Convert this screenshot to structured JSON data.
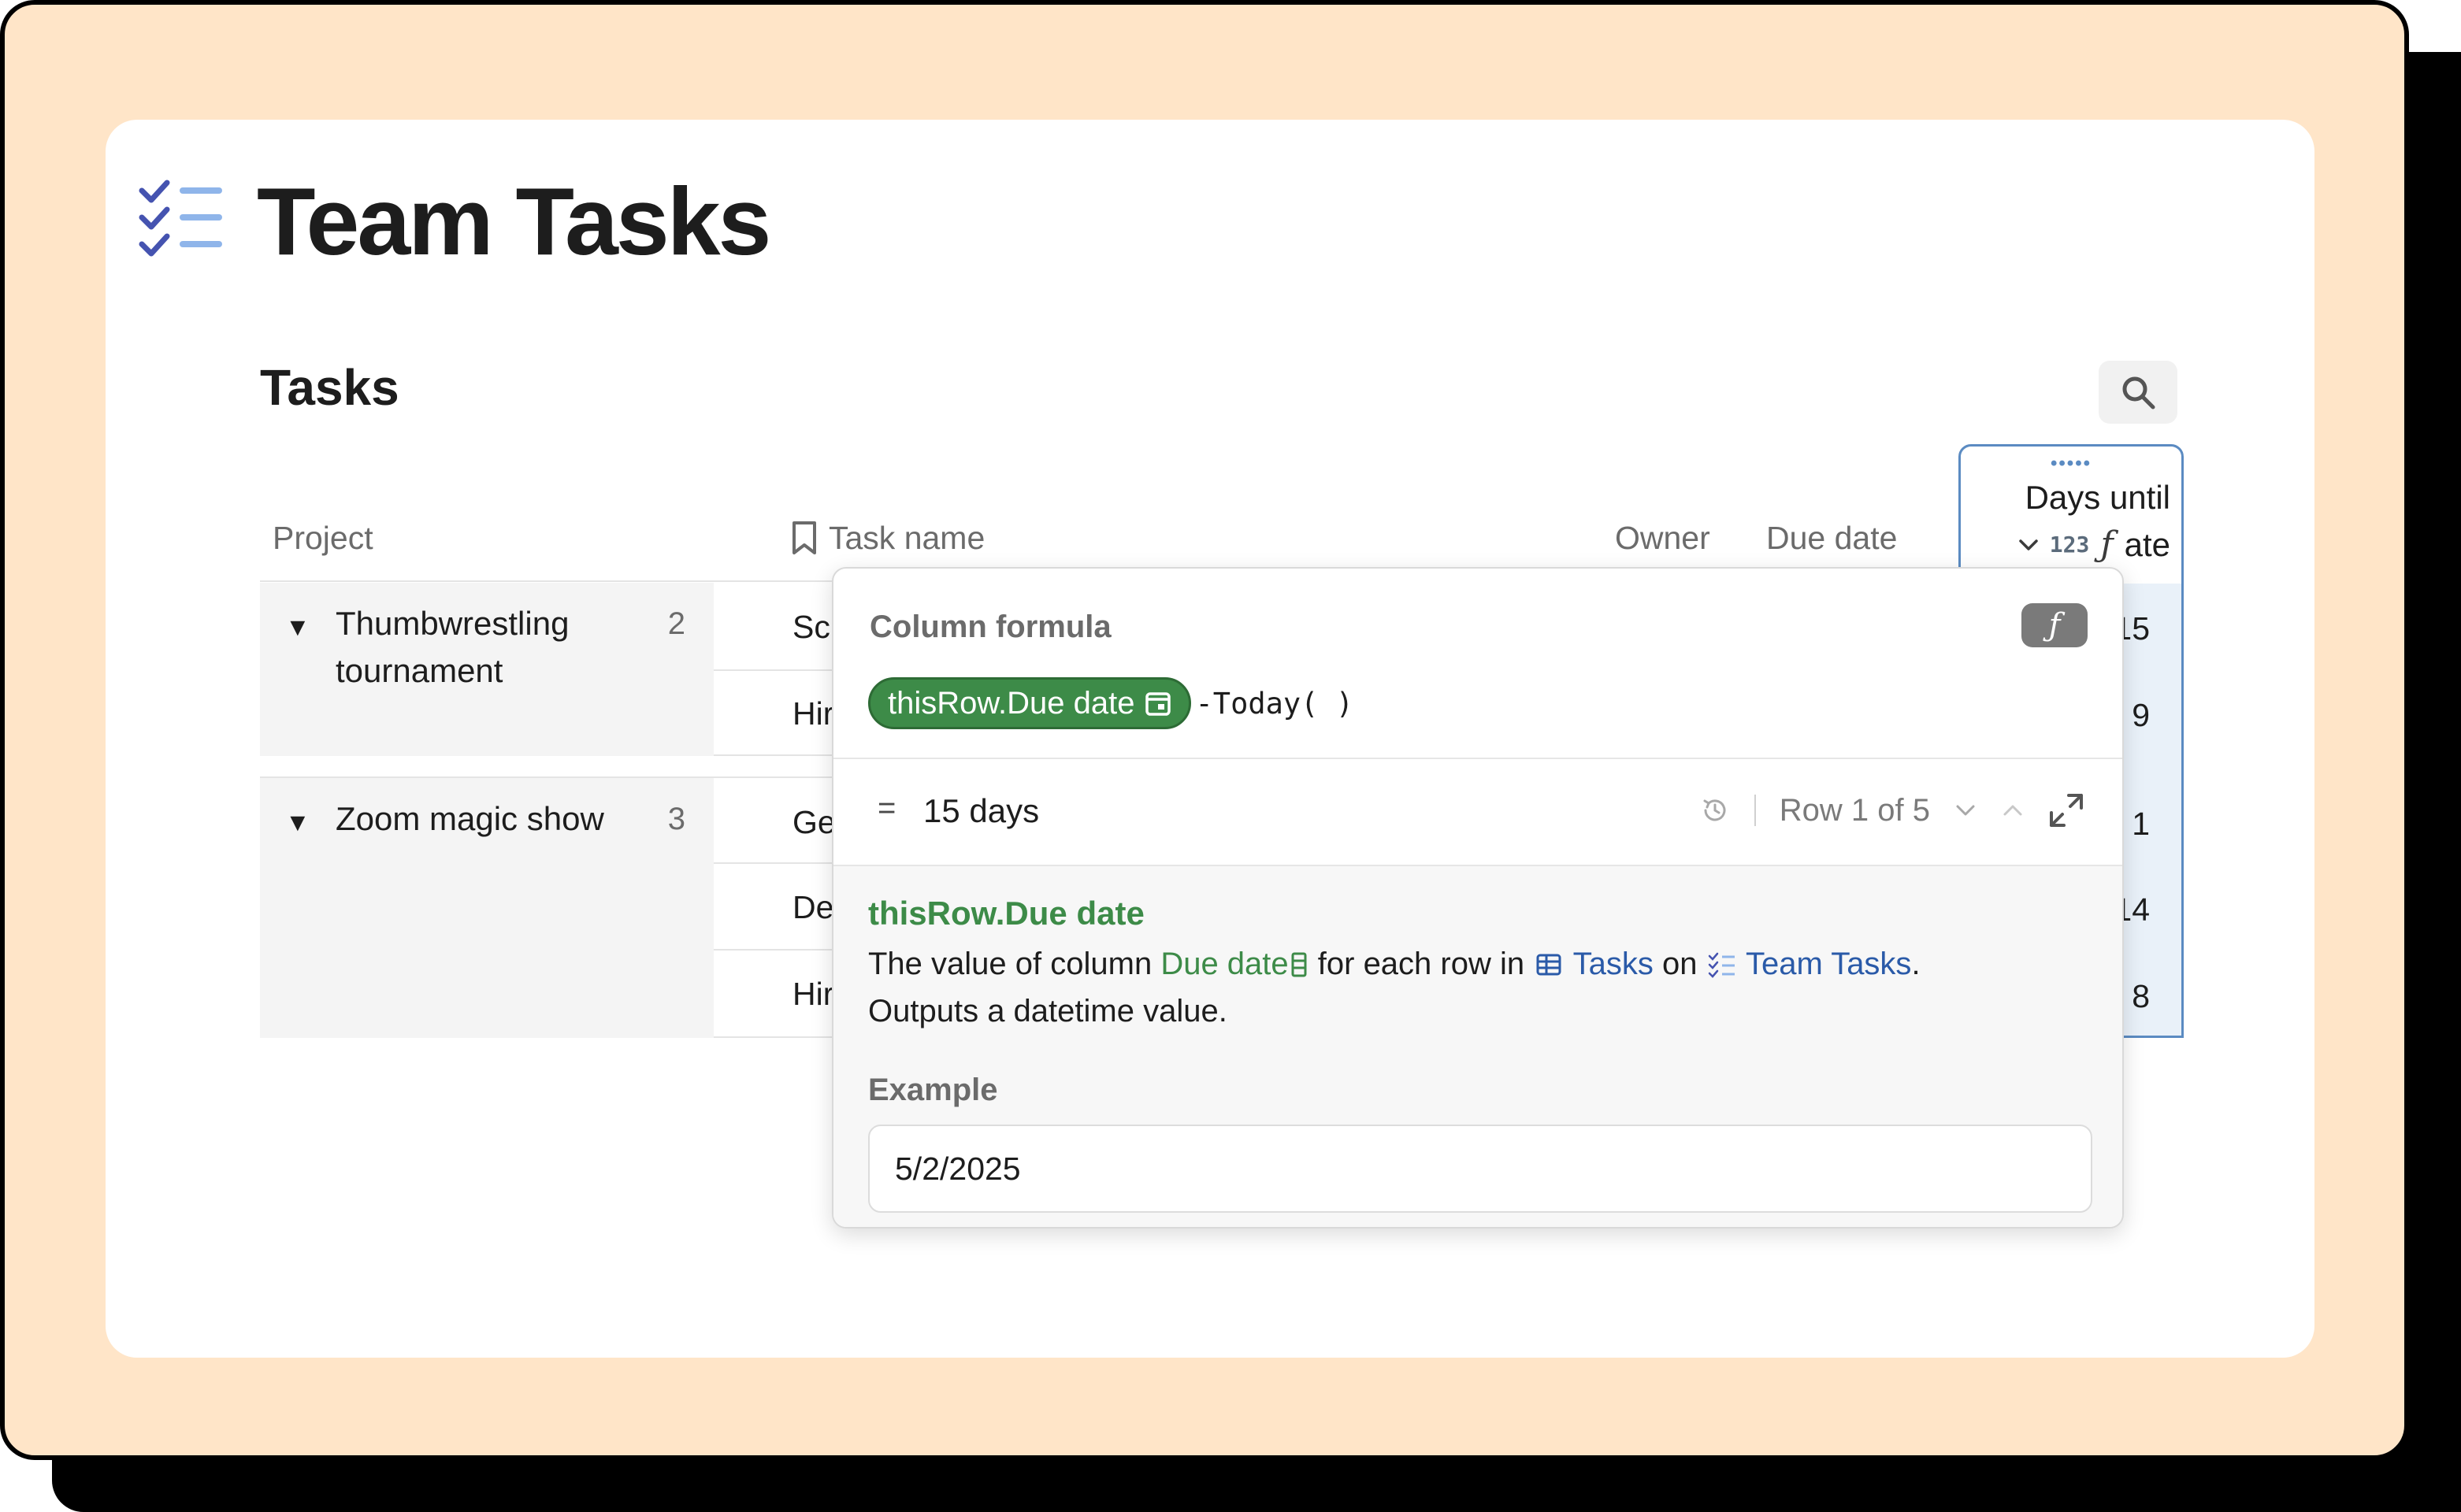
{
  "document": {
    "title": "Team Tasks",
    "icon": "checklist-icon",
    "accent_color": "#5b6fc7"
  },
  "table": {
    "title": "Tasks",
    "columns": [
      "Project",
      "Task name",
      "Owner",
      "Due date"
    ],
    "days_column": {
      "title_line1": "Days until",
      "title_line2": "ate",
      "type_icon": "123"
    },
    "groups": [
      {
        "name": "Thumbwrestling tournament",
        "count": "2",
        "tasks": [
          "Sc",
          "Hir"
        ],
        "days": [
          "15",
          "9"
        ]
      },
      {
        "name": "Zoom magic show",
        "count": "3",
        "tasks": [
          "Ge",
          "De",
          "Hir"
        ],
        "days": [
          "1",
          "14",
          "8"
        ]
      }
    ]
  },
  "popover": {
    "title": "Column formula",
    "formula_chip": "thisRow.Due date",
    "formula_rest": "-Today( )",
    "result_eq": "=",
    "result": "15 days",
    "row_nav": "Row 1 of 5",
    "help": {
      "title": "thisRow.Due date",
      "desc_prefix": "The value of column ",
      "desc_column": "Due date",
      "desc_mid": " for each row in ",
      "desc_table": "Tasks",
      "desc_on": " on ",
      "desc_doc": "Team Tasks",
      "desc_end": ".",
      "desc_line2": "Outputs a datetime value.",
      "example_label": "Example",
      "example_value": "5/2/2025"
    }
  },
  "colors": {
    "frame_bg": "#FFE5C8",
    "chip_green": "#3d8b48",
    "link_blue": "#2a5aa8",
    "selection_blue": "#5b8bc2"
  }
}
